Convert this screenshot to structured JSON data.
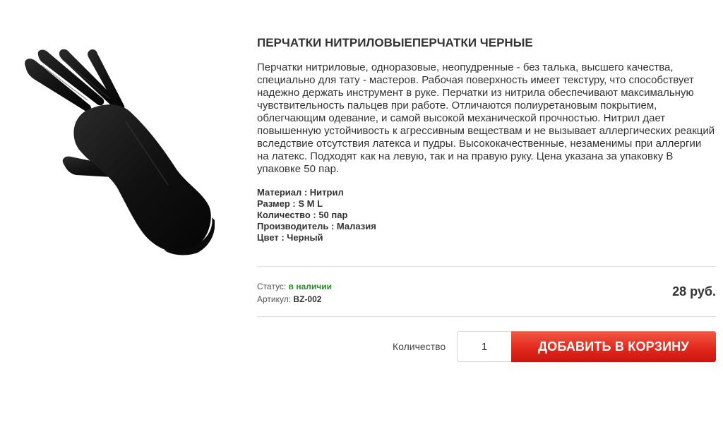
{
  "product": {
    "title": "ПЕРЧАТКИ НИТРИЛОВЫЕПЕРЧАТКИ ЧЕРНЫЕ",
    "description": "Перчатки нитриловые, одноразовые, неопудренные - без талька, высшего качества, специально для тату - мастеров. Рабочая поверхность имеет текстуру, что способствует надежно держать инструмент в руке. Перчатки из нитрила обеспечивают максимальную чувствительность пальцев при работе. Отличаются полиуретановым покрытием, облегчающим одевание, и самой высокой механической прочностью. Нитрил дает повышенную устойчивость к агрессивным веществам и не вызывает аллергических реакций вследствие отсутствия латекса и пудры. Высококачественные, незаменимы при аллергии на латекс. Подходят как на левую, так и на правую руку. Цена указана за упаковку В упаковке 50 пар.",
    "image_icon": "black-nitrile-glove",
    "specs": [
      {
        "label": "Материал : Нитрил"
      },
      {
        "label": "Размер : S M L"
      },
      {
        "label": "Количество : 50 пар"
      },
      {
        "label": "Производитель : Малазия"
      },
      {
        "label": "Цвет : Черный"
      }
    ]
  },
  "meta": {
    "status_label": "Статус:",
    "status_value": "в наличии",
    "sku_label": "Артикул:",
    "sku_value": "BZ-002"
  },
  "price": "28 руб.",
  "cart": {
    "quantity_label": "Количество",
    "quantity_value": "1",
    "add_button_label": "ДОБАВИТЬ В КОРЗИНУ"
  },
  "colors": {
    "accent_button": "#e22a1d",
    "status_in_stock": "#2a8a2a"
  }
}
